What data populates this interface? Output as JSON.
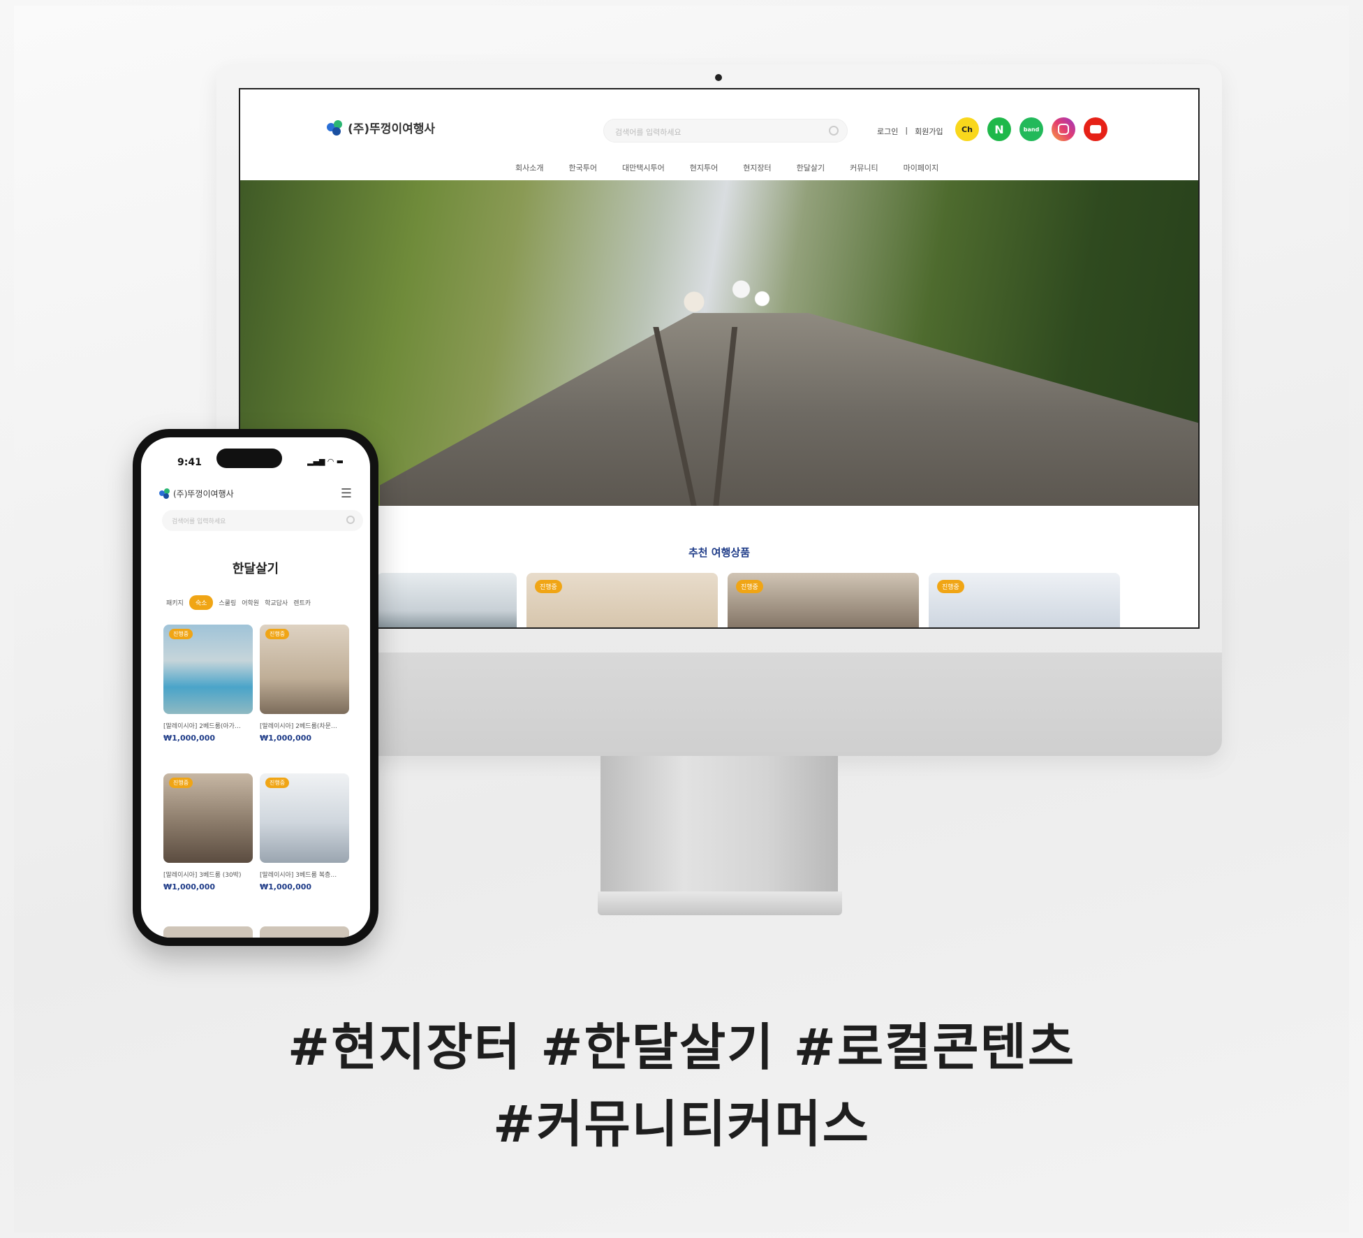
{
  "brand": {
    "name": "(주)뚜껑이여행사",
    "colors": {
      "accent": "#f0a515",
      "navy": "#1f3c88",
      "logo_blue": "#2a6fd6",
      "logo_green": "#2bb673"
    }
  },
  "desktop": {
    "search_placeholder": "검색어를 입력하세요",
    "top_links": [
      "로그인",
      "|",
      "회원가입"
    ],
    "social_icons": [
      "kakao-channel-icon",
      "naver-icon",
      "band-icon",
      "instagram-icon",
      "youtube-icon"
    ],
    "social_labels": {
      "kakao": "Ch",
      "naver": "N",
      "band": "band"
    },
    "nav": [
      "회사소개",
      "한국투어",
      "대만택시투어",
      "현지투어",
      "현지장터",
      "한달살기",
      "커뮤니티",
      "마이페이지"
    ],
    "section_title": "추천 여행상품",
    "badge": "진행중"
  },
  "mobile": {
    "time": "9:41",
    "status_icons": "▂▄▆ ◠ ▬",
    "search_placeholder": "검색어를 입력하세요",
    "page_title": "한달살기",
    "tabs": [
      "패키지",
      "숙소",
      "스쿨링",
      "어학원",
      "학교답사",
      "렌트카"
    ],
    "active_tab": "숙소",
    "products": [
      {
        "name": "[말레이시아] 2베드룸(아가…",
        "price": "₩1,000,000",
        "badge": "진행중"
      },
      {
        "name": "[말레이시아] 2베드룸(차문…",
        "price": "₩1,000,000",
        "badge": "진행중"
      },
      {
        "name": "[말레이시아] 3베드룸 (30박)",
        "price": "₩1,000,000",
        "badge": "진행중"
      },
      {
        "name": "[말레이시아] 3베드룸 복층…",
        "price": "₩1,000,000",
        "badge": "진행중"
      }
    ]
  },
  "tagline": {
    "line1": "#현지장터 #한달살기 #로컬콘텐츠",
    "line2": "#커뮤니티커머스"
  }
}
